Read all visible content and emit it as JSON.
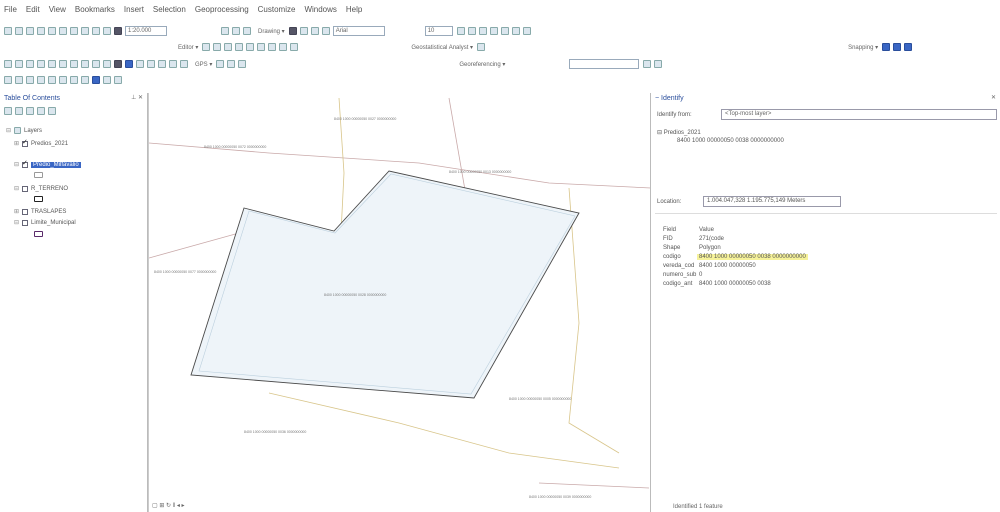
{
  "menu": [
    "File",
    "Edit",
    "View",
    "Bookmarks",
    "Insert",
    "Selection",
    "Geoprocessing",
    "Customize",
    "Windows",
    "Help"
  ],
  "toolbar": {
    "scale": "1:20.000",
    "drawing_label": "Drawing ▾",
    "font_name": "Arial",
    "font_size": "10",
    "editor_label": "Editor ▾",
    "geostat_label": "Geostatistical Analyst ▾",
    "snapping_label": "Snapping ▾",
    "gps_label": "GPS ▾",
    "georef_label": "Georeferencing ▾"
  },
  "toc": {
    "title": "Table Of Contents",
    "root": "Layers",
    "layers": [
      {
        "name": "Predios_2021",
        "checked": true
      },
      {
        "name": "Predio_Milfavalio",
        "checked": true,
        "selected": true
      },
      {
        "name": "R_TERRENO",
        "checked": false
      },
      {
        "name": "TRASLAPES",
        "checked": false
      },
      {
        "name": "Limite_Municipal",
        "checked": false
      }
    ]
  },
  "map": {
    "labels": [
      "8400 1000 00000050 0072 0000000000",
      "8400 1000 00000050 0027 0000000000",
      "8400 1000 00000050 0013 0000000000",
      "8400 1000 00000050 0077 0000000000",
      "8400 1000 00000050 0028 0000000000",
      "8400 1000 00000050 0005 0000000000",
      "8400 1000 00000050 0036 0000000000",
      "8400 1000 00000050 0039 0000000000"
    ],
    "footer": "▢ ⊞ ↻ ‖ ◂ ▸"
  },
  "identify": {
    "title": "Identify",
    "identify_from_label": "Identify from:",
    "identify_from_value": "<Top-most layer>",
    "tree_parent": "Predios_2021",
    "tree_child": "8400 1000 00000050 0038 0000000000",
    "location_label": "Location:",
    "location_value": "1.004.047,328  1.195.775,149 Meters",
    "header_field": "Field",
    "header_value": "Value",
    "rows": [
      {
        "field": "FID",
        "value": "271(code",
        "highlight": false
      },
      {
        "field": "Shape",
        "value": "Polygon",
        "highlight": false
      },
      {
        "field": "codigo",
        "value": "8400 1000 00000050 0038 0000000000",
        "highlight": true
      },
      {
        "field": "vereda_cod",
        "value": "8400 1000 00000050",
        "highlight": false
      },
      {
        "field": "numero_sub",
        "value": "0",
        "highlight": false
      },
      {
        "field": "codigo_ant",
        "value": "8400 1000 00000050 0038",
        "highlight": false
      }
    ],
    "footer": "Identified 1 feature"
  },
  "colors": {
    "accent": "#3a66c4",
    "highlight": "#f6f29a",
    "polygon_fill": "#eef4f9"
  }
}
